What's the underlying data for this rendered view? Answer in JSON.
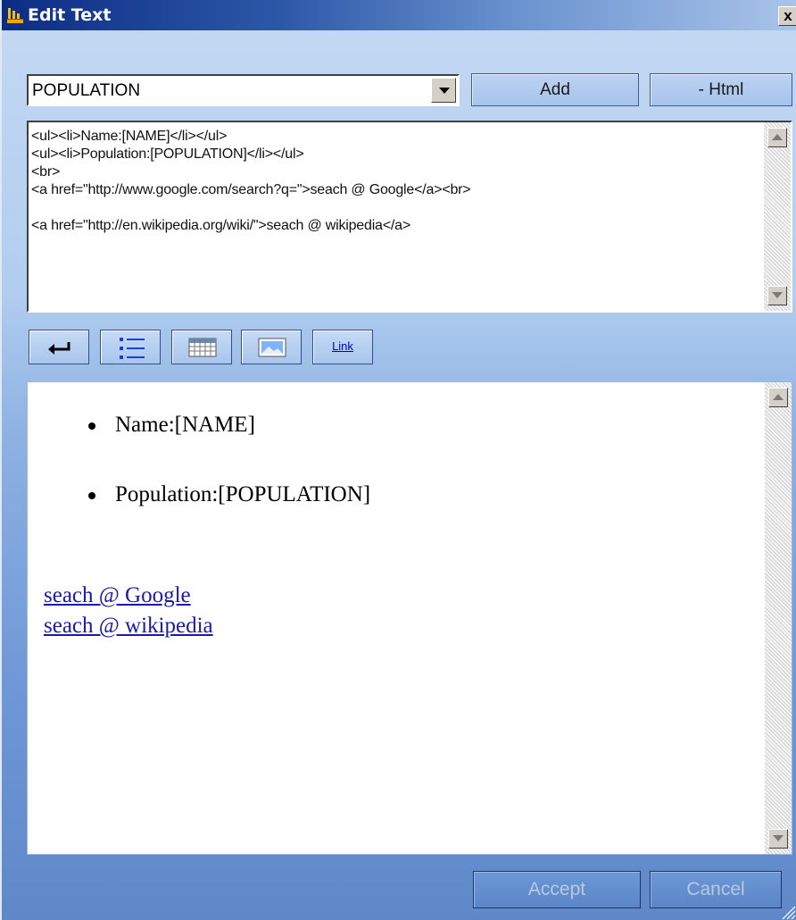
{
  "window": {
    "title": "Edit Text",
    "close_label": "x"
  },
  "field_select": {
    "selected": "POPULATION"
  },
  "buttons": {
    "add": "Add",
    "html": "- Html",
    "accept": "Accept",
    "cancel": "Cancel"
  },
  "source_html": "<ul><li>Name:[NAME]</li></ul>\n<ul><li>Population:[POPULATION]</li></ul>\n<br>\n<a href=\"http://www.google.com/search?q=\">seach @ Google</a><br>\n\n<a href=\"http://en.wikipedia.org/wiki/\">seach @ wikipedia</a>",
  "toolbar": {
    "items": [
      {
        "name": "enter",
        "icon": "enter-icon"
      },
      {
        "name": "list",
        "icon": "list-icon"
      },
      {
        "name": "table",
        "icon": "table-icon"
      },
      {
        "name": "image",
        "icon": "image-icon"
      },
      {
        "name": "link",
        "label": "Link"
      }
    ]
  },
  "preview": {
    "list_items": [
      "Name:[NAME]",
      "Population:[POPULATION]"
    ],
    "links": [
      "seach @ Google",
      "seach @ wikipedia"
    ]
  },
  "colors": {
    "titlebar_start": "#0c2c84",
    "titlebar_end": "#a9c4e9",
    "link": "#1a1aaa"
  }
}
